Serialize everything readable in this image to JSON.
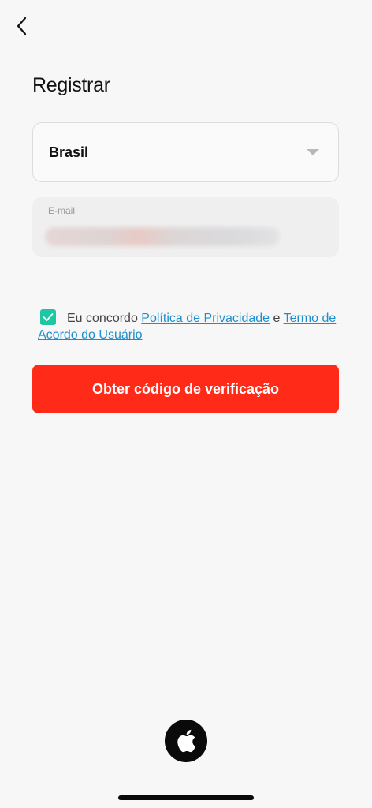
{
  "header": {
    "back_icon": "chevron-left-icon",
    "title": "Registrar"
  },
  "form": {
    "country": {
      "value": "Brasil",
      "icon": "caret-down-icon"
    },
    "email": {
      "label": "E-mail",
      "value_obscured": true
    },
    "agreement": {
      "checked": true,
      "prefix": "Eu concordo",
      "privacy_link": "Política de Privacidade",
      "conjunction": "e",
      "terms_link": "Termo de Acordo do Usuário"
    },
    "submit_label": "Obter código de verificação"
  },
  "social_login": {
    "apple_icon": "apple-logo-icon"
  },
  "colors": {
    "primary": "#ff2a17",
    "checkbox": "#1ec6a2",
    "link": "#1a8fd0",
    "background": "#f7f7f7"
  }
}
